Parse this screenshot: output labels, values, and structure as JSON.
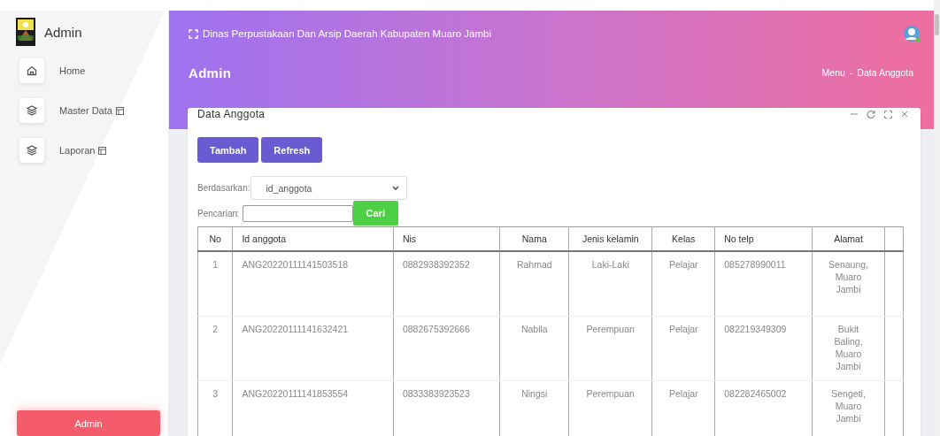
{
  "sidebar": {
    "brand": "Admin",
    "items": [
      {
        "label": "Home",
        "kind": "home",
        "submenu": false
      },
      {
        "label": "Master Data",
        "kind": "layers",
        "submenu": true
      },
      {
        "label": "Laporan",
        "kind": "layers",
        "submenu": true
      }
    ],
    "footer_button": "Admin"
  },
  "header": {
    "title": "Dinas Perpustakaan Dan Arsip Daerah Kabupaten Muaro Jambi",
    "page_title": "Admin",
    "breadcrumb": [
      "Menu",
      "Data Anggota"
    ],
    "breadcrumb_separator": "-"
  },
  "card": {
    "title": "Data Anggota",
    "buttons": [
      "Tambah",
      "Refresh"
    ],
    "filter": {
      "label": "Berdasarkan:",
      "value": "id_anggota"
    },
    "search": {
      "label": "Pencarian",
      "colon": ":",
      "button": "Cari"
    },
    "table": {
      "columns": [
        "No",
        "Id anggota",
        "Nis",
        "Nama",
        "Jenis kelamin",
        "Kelas",
        "No telp",
        "Alamat"
      ],
      "rows": [
        [
          "1",
          "ANG20220111141503518",
          "0882938392352",
          "Rahmad",
          "Laki-Laki",
          "Pelajar",
          "085278990011",
          "Senaung, Muaro Jambi"
        ],
        [
          "2",
          "ANG20220111141632421",
          "0882675392666",
          "Nabila",
          "Perempuan",
          "Pelajar",
          "082219349309",
          "Bukit Baling, Muaro Jambi"
        ],
        [
          "3",
          "ANG20220111141853554",
          "0833383923523",
          "Ningsi",
          "Perempuan",
          "Pelajar",
          "082282465002",
          "Sengeti, Muaro Jambi"
        ]
      ]
    }
  }
}
